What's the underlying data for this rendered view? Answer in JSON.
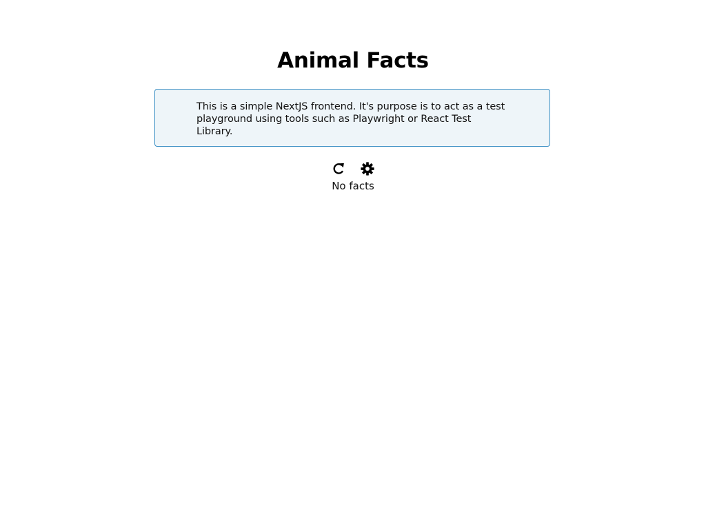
{
  "header": {
    "title": "Animal Facts"
  },
  "info": {
    "text": "This is a simple NextJS frontend. It's purpose is to act as a test playground using tools such as Playwright or React Test Library."
  },
  "toolbar": {
    "buttons": [
      {
        "icon": "refresh-icon",
        "symbol": "↻"
      },
      {
        "icon": "gear-icon",
        "symbol": "⚙"
      }
    ]
  },
  "facts": {
    "empty_label": "No facts",
    "items": []
  },
  "colors": {
    "info_background": "#eef5f9",
    "info_border": "#3b8fc4",
    "text": "#111111"
  }
}
